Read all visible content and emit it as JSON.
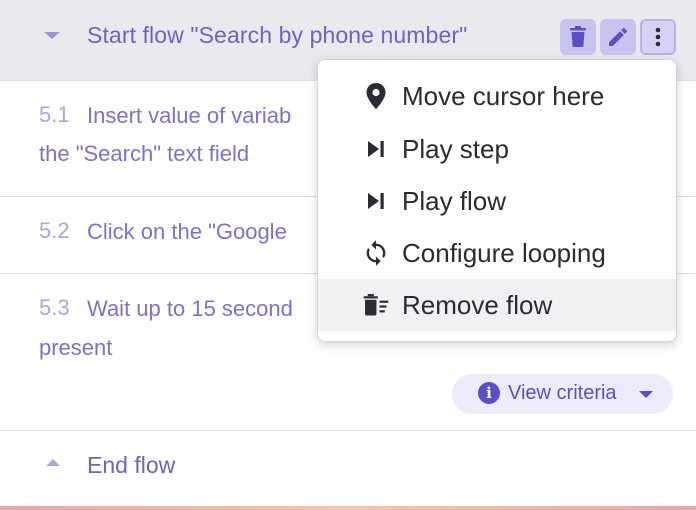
{
  "header": {
    "title": "Start flow \"Search by phone number\"",
    "icons": [
      "chevron-down-icon",
      "trash-icon",
      "pencil-icon",
      "more-vertical-icon"
    ]
  },
  "steps": [
    {
      "number": "5.1",
      "line1": "Insert value of variab",
      "line2": "the \"Search\" text field"
    },
    {
      "number": "5.2",
      "line1": "Click on the \"Google"
    },
    {
      "number": "5.3",
      "line1": "Wait up to 15 second",
      "line2": "present"
    }
  ],
  "criteria": {
    "label": "View criteria",
    "icon": "info-icon"
  },
  "end": {
    "label": "End flow",
    "icon": "chevron-up-icon"
  },
  "menu": {
    "items": [
      {
        "label": "Move cursor here",
        "icon": "map-pin-icon"
      },
      {
        "label": "Play step",
        "icon": "skip-next-icon"
      },
      {
        "label": "Play flow",
        "icon": "skip-next-icon"
      },
      {
        "label": "Configure looping",
        "icon": "loop-icon"
      },
      {
        "label": "Remove flow",
        "icon": "delete-sweep-icon",
        "active": true
      }
    ]
  },
  "colors": {
    "accent": "#6c63c7",
    "header_bg": "#e9e9ee",
    "button_bg": "#c8c4ef",
    "criteria_bg": "#ecebfa"
  }
}
